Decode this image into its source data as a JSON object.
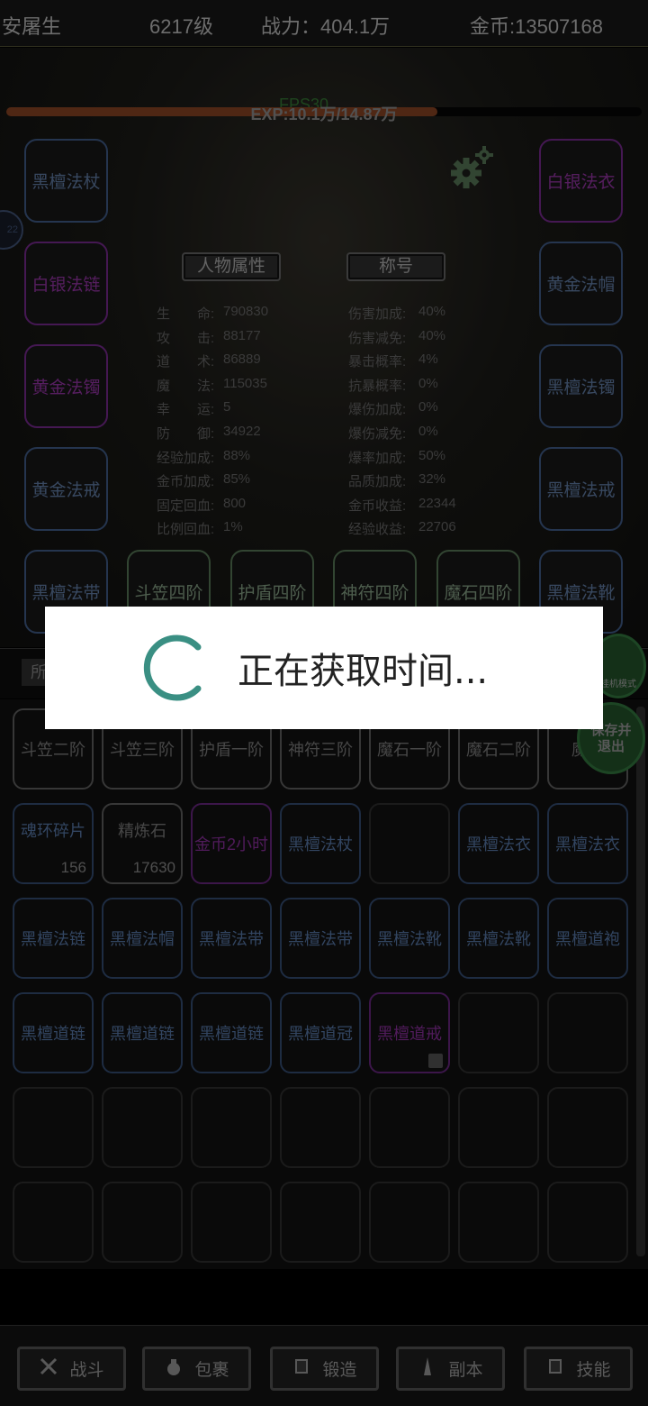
{
  "header": {
    "player_name": "安屠生",
    "level": "6217级",
    "power": "战力：404.1万",
    "gold": "金币:13507168"
  },
  "fps": "FPS30",
  "exp": {
    "text": "EXP:10.1万/14.87万",
    "progress": 0.679
  },
  "equipment": {
    "left": [
      {
        "label": "黑檀法杖",
        "rarity": "blue"
      },
      {
        "label": "白银法链",
        "rarity": "purple"
      },
      {
        "label": "黄金法镯",
        "rarity": "purple"
      },
      {
        "label": "黄金法戒",
        "rarity": "blue"
      },
      {
        "label": "黑檀法带",
        "rarity": "blue"
      }
    ],
    "right": [
      {
        "label": "白银法衣",
        "rarity": "purple"
      },
      {
        "label": "黄金法帽",
        "rarity": "blue"
      },
      {
        "label": "黑檀法镯",
        "rarity": "blue"
      },
      {
        "label": "黑檀法戒",
        "rarity": "blue"
      },
      {
        "label": "黑檀法靴",
        "rarity": "blue"
      }
    ],
    "bottom": [
      {
        "label": "斗笠四阶"
      },
      {
        "label": "护盾四阶"
      },
      {
        "label": "神符四阶"
      },
      {
        "label": "魔石四阶"
      }
    ]
  },
  "tabs": {
    "attributes": "人物属性",
    "title": "称号"
  },
  "stats_left": [
    {
      "k": "生　　命:",
      "v": "790830"
    },
    {
      "k": "攻　　击:",
      "v": "88177"
    },
    {
      "k": "道　　术:",
      "v": "86889"
    },
    {
      "k": "魔　　法:",
      "v": "115035"
    },
    {
      "k": "幸　　运:",
      "v": "5"
    },
    {
      "k": "防　　御:",
      "v": "34922"
    },
    {
      "k": "经验加成:",
      "v": "88%"
    },
    {
      "k": "金币加成:",
      "v": "85%"
    },
    {
      "k": "固定回血:",
      "v": "800"
    },
    {
      "k": "比例回血:",
      "v": "1%"
    }
  ],
  "stats_right": [
    {
      "k": "伤害加成:",
      "v": "40%"
    },
    {
      "k": "伤害减免:",
      "v": "40%"
    },
    {
      "k": "暴击概率:",
      "v": "4%"
    },
    {
      "k": "抗暴概率:",
      "v": "0%"
    },
    {
      "k": "爆伤加成:",
      "v": "0%"
    },
    {
      "k": "爆伤减免:",
      "v": "0%"
    },
    {
      "k": "爆率加成:",
      "v": "50%"
    },
    {
      "k": "品质加成:",
      "v": "32%"
    },
    {
      "k": "金币收益:",
      "v": "22344"
    },
    {
      "k": "经验收益:",
      "v": "22706"
    }
  ],
  "side_badge": "22",
  "filter_label": "所",
  "mode_button": "挂机模式",
  "save_button": "保存并退出",
  "inventory": [
    [
      {
        "label": "斗笠二阶",
        "type": "gray"
      },
      {
        "label": "斗笠三阶",
        "type": "gray"
      },
      {
        "label": "护盾一阶",
        "type": "gray"
      },
      {
        "label": "神符三阶",
        "type": "gray"
      },
      {
        "label": "魔石一阶",
        "type": "gray"
      },
      {
        "label": "魔石二阶",
        "type": "gray"
      },
      {
        "label": "魔石",
        "type": "gray"
      }
    ],
    [
      {
        "label": "魂环碎片",
        "type": "blue",
        "count": "156"
      },
      {
        "label": "精炼石",
        "type": "gray",
        "count": "17630"
      },
      {
        "label": "金币2小时",
        "type": "purple"
      },
      {
        "label": "黑檀法杖",
        "type": "blue"
      },
      {
        "label": "",
        "type": "empty"
      },
      {
        "label": "黑檀法衣",
        "type": "blue"
      },
      {
        "label": "黑檀法衣",
        "type": "blue"
      }
    ],
    [
      {
        "label": "黑檀法链",
        "type": "blue"
      },
      {
        "label": "黑檀法帽",
        "type": "blue"
      },
      {
        "label": "黑檀法带",
        "type": "blue"
      },
      {
        "label": "黑檀法带",
        "type": "blue"
      },
      {
        "label": "黑檀法靴",
        "type": "blue"
      },
      {
        "label": "黑檀法靴",
        "type": "blue"
      },
      {
        "label": "黑檀道袍",
        "type": "blue"
      }
    ],
    [
      {
        "label": "黑檀道链",
        "type": "blue"
      },
      {
        "label": "黑檀道链",
        "type": "blue"
      },
      {
        "label": "黑檀道链",
        "type": "blue"
      },
      {
        "label": "黑檀道冠",
        "type": "blue"
      },
      {
        "label": "黑檀道戒",
        "type": "purple",
        "locked": true
      },
      {
        "label": "",
        "type": "empty"
      },
      {
        "label": "",
        "type": "empty"
      }
    ],
    [
      {
        "label": "",
        "type": "empty"
      },
      {
        "label": "",
        "type": "empty"
      },
      {
        "label": "",
        "type": "empty"
      },
      {
        "label": "",
        "type": "empty"
      },
      {
        "label": "",
        "type": "empty"
      },
      {
        "label": "",
        "type": "empty"
      },
      {
        "label": "",
        "type": "empty"
      }
    ],
    [
      {
        "label": "",
        "type": "empty"
      },
      {
        "label": "",
        "type": "empty"
      },
      {
        "label": "",
        "type": "empty"
      },
      {
        "label": "",
        "type": "empty"
      },
      {
        "label": "",
        "type": "empty"
      },
      {
        "label": "",
        "type": "empty"
      },
      {
        "label": "",
        "type": "empty"
      }
    ]
  ],
  "bottom_nav": [
    {
      "label": "战斗",
      "icon": "crossed-swords-icon"
    },
    {
      "label": "包裹",
      "icon": "bag-icon"
    },
    {
      "label": "锻造",
      "icon": "book-icon"
    },
    {
      "label": "副本",
      "icon": "tower-icon"
    },
    {
      "label": "技能",
      "icon": "book-icon"
    }
  ],
  "dialog": {
    "text": "正在获取时间..."
  },
  "colors": {
    "spinner": "#3a8f83",
    "exp_fill": "#7a3d20",
    "blue_item": "#4e6b96",
    "purple_item": "#7c2a8c"
  }
}
